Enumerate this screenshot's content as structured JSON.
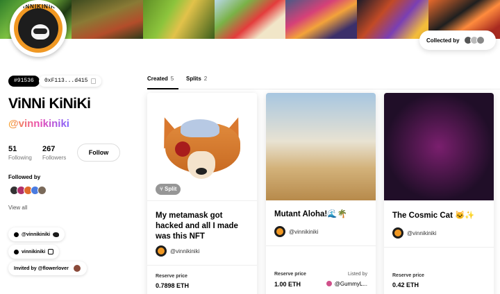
{
  "profile": {
    "avatar_ring_text": "VINNIKINIKI",
    "token_id": "#91536",
    "address": "0xF113...d415",
    "name": "ViNNi KiNiKi",
    "handle": "@vinnikiniki",
    "following_count": "51",
    "following_label": "Following",
    "followers_count": "267",
    "followers_label": "Followers",
    "follow_label": "Follow",
    "followed_by_label": "Followed by",
    "view_all_label": "View all",
    "twitter_handle": "@vinnikiniki",
    "instagram_handle": "vinnikiniki",
    "invited_by": "Invited by @flowerlover"
  },
  "collected_by_label": "Collected by",
  "tabs": [
    {
      "label": "Created",
      "count": "5"
    },
    {
      "label": "Splits",
      "count": "2"
    }
  ],
  "cards": [
    {
      "title": "My metamask got hacked and all I made was this NFT",
      "creator": "@vinnikiniki",
      "badge": "Split",
      "reserve_label": "Reserve price",
      "reserve_value": "0.7898 ETH"
    },
    {
      "title": "Mutant Aloha!🌊🌴",
      "creator": "@vinnikiniki",
      "reserve_label": "Reserve price",
      "reserve_value": "1.00 ETH",
      "listed_label": "Listed by",
      "listed_value": "@GummyL..."
    },
    {
      "title": "The Cosmic Cat 🐱✨",
      "creator": "@vinnikiniki",
      "reserve_label": "Reserve price",
      "reserve_value": "0.42 ETH"
    }
  ],
  "colors": {
    "accent_gradient": [
      "#f7a531",
      "#e94ab4",
      "#7f63ff"
    ],
    "avatar_orange": "#f09823"
  },
  "icons": [
    "copy-icon",
    "twitter-icon",
    "instagram-icon",
    "split-icon"
  ]
}
